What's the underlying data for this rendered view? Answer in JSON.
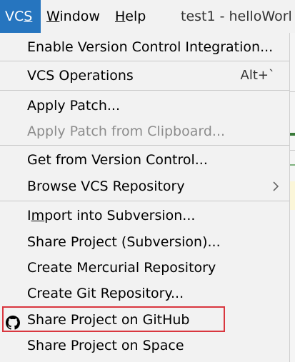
{
  "menubar": {
    "vcs": "VCS",
    "vcs_underline": "S",
    "window": "Window",
    "help": "Help",
    "title": "test1 - helloWorl"
  },
  "menu": {
    "items": [
      {
        "label": "Enable Version Control Integration..."
      },
      {
        "label": "VCS Operations",
        "shortcut": "Alt+`"
      },
      {
        "label": "Apply Patch..."
      },
      {
        "label": "Apply Patch from Clipboard...",
        "disabled": true
      },
      {
        "label": "Get from Version Control..."
      },
      {
        "label": "Browse VCS Repository"
      },
      {
        "label": "Import into Subversion..."
      },
      {
        "label": "Share Project (Subversion)..."
      },
      {
        "label": "Create Mercurial Repository"
      },
      {
        "label": "Create Git Repository..."
      },
      {
        "label": "Share Project on GitHub"
      },
      {
        "label": "Share Project on Space"
      }
    ]
  },
  "colors": {
    "menu_active": "#2675bf",
    "highlight_border": "#d9363e"
  }
}
